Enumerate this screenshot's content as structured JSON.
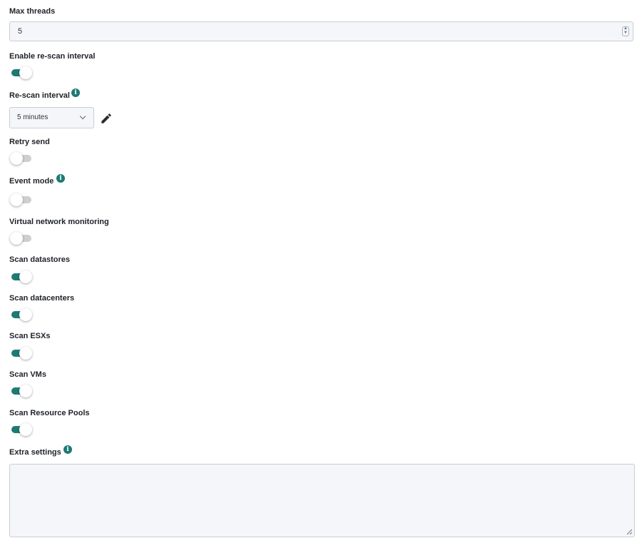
{
  "max_threads": {
    "label": "Max threads",
    "value": "5"
  },
  "enable_rescan": {
    "label": "Enable re-scan interval",
    "checked": true
  },
  "rescan_interval": {
    "label": "Re-scan interval",
    "selected": "5 minutes",
    "info_icon": "info-icon",
    "edit_icon": "pencil-icon"
  },
  "retry_send": {
    "label": "Retry send",
    "checked": false
  },
  "event_mode": {
    "label": "Event mode",
    "checked": false,
    "info_icon": "info-icon"
  },
  "virtual_network_monitoring": {
    "label": "Virtual network monitoring",
    "checked": false
  },
  "scan_datastores": {
    "label": "Scan datastores",
    "checked": true
  },
  "scan_datacenters": {
    "label": "Scan datacenters",
    "checked": true
  },
  "scan_esxs": {
    "label": "Scan ESXs",
    "checked": true
  },
  "scan_vms": {
    "label": "Scan VMs",
    "checked": true
  },
  "scan_resource_pools": {
    "label": "Scan Resource Pools",
    "checked": true
  },
  "extra_settings": {
    "label": "Extra settings",
    "value": "",
    "info_icon": "info-icon"
  },
  "colors": {
    "accent": "#1f7a73",
    "toggle_off": "#cfcfcf",
    "field_background": "#f4f6fa",
    "field_border": "#c9ced6"
  }
}
